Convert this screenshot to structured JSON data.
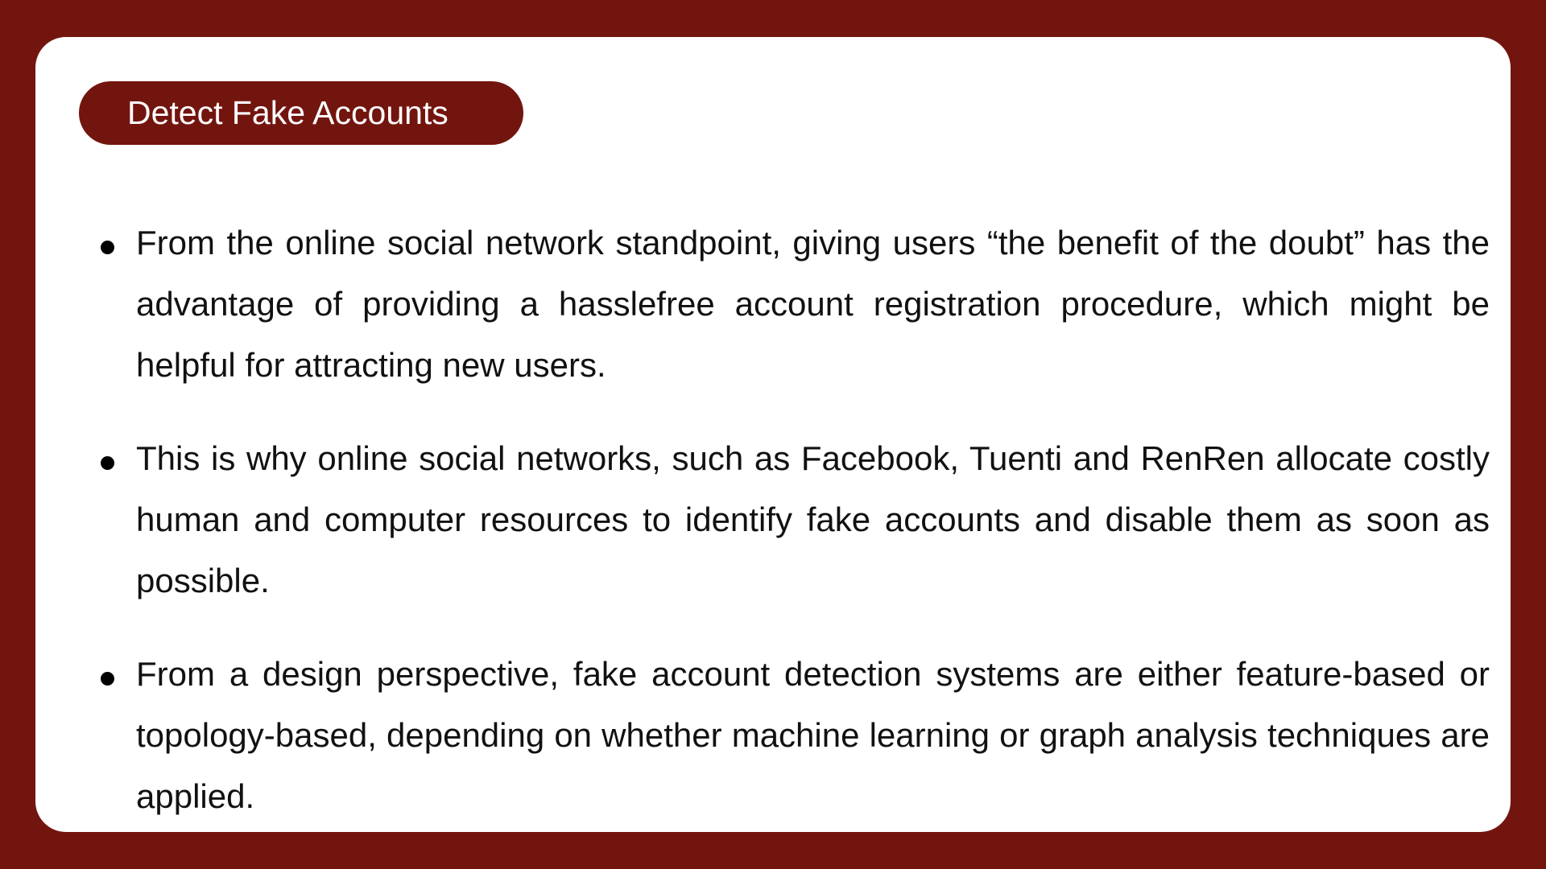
{
  "slide": {
    "title": "Detect Fake Accounts",
    "bullets": [
      "From the online social network standpoint, giving users “the benefit of the doubt” has the advantage of providing a hasslefree account registration procedure, which might be helpful for attracting new users.",
      "This is why online social networks, such as Facebook, Tuenti and RenRen allocate costly human and computer resources to identify fake accounts and disable them as soon as possible.",
      "From a design perspective, fake account detection systems are either feature-based or topology-based, depending on whether machine learning or graph analysis techniques are applied."
    ]
  },
  "colors": {
    "background": "#73150f",
    "card": "#ffffff",
    "text": "#111111"
  }
}
